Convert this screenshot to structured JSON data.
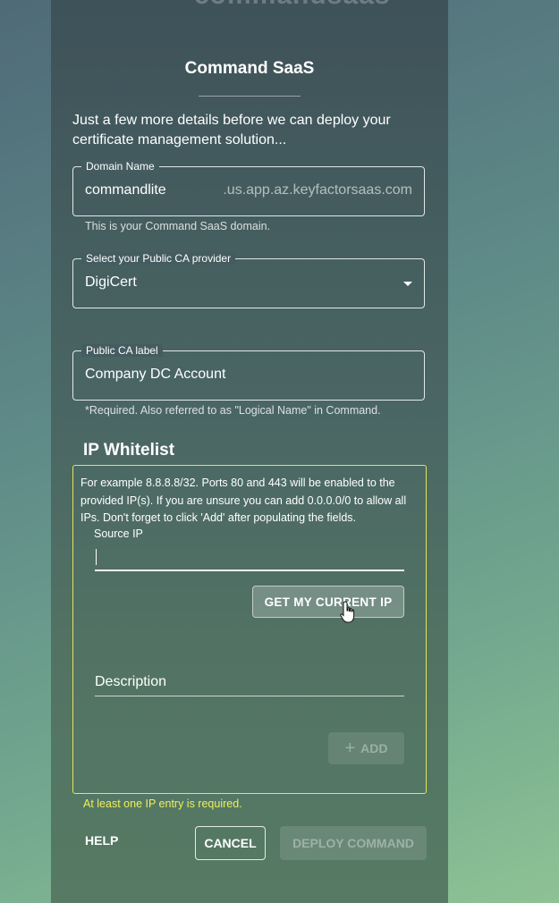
{
  "brand": {
    "logo_text": "commandsaas"
  },
  "page": {
    "title": "Command SaaS",
    "intro": "Just a few more details before we can deploy your certificate management solution..."
  },
  "domain_field": {
    "label": "Domain Name",
    "value": "commandlite",
    "suffix": ".us.app.az.keyfactorsaas.com",
    "helper": "This is your Command SaaS domain."
  },
  "ca_provider_field": {
    "label": "Select your Public CA provider",
    "value": "DigiCert"
  },
  "ca_label_field": {
    "label": "Public CA label",
    "value": "Company DC Account",
    "helper": "*Required. Also referred to as \"Logical Name\" in Command."
  },
  "ip_whitelist": {
    "title": "IP Whitelist",
    "description": "For example 8.8.8.8/32. Ports 80 and 443 will be enabled to the provided IP(s). If you are unsure you can add 0.0.0.0/0 to allow all IPs. Don't forget to click 'Add' after populating the fields.",
    "source_ip_label": "Source IP",
    "source_ip_value": "",
    "get_ip_button": "GET MY CURRENT IP",
    "description_label": "Description",
    "add_button": "ADD",
    "error": "At least one IP entry is required."
  },
  "actions": {
    "help": "HELP",
    "cancel": "CANCEL",
    "deploy": "DEPLOY COMMAND"
  },
  "colors": {
    "error": "#eef05a",
    "whitelist_border": "#e3e35a"
  },
  "icons": {
    "dropdown": "triangle-down",
    "add": "plus",
    "cursor": "hand-pointer"
  }
}
